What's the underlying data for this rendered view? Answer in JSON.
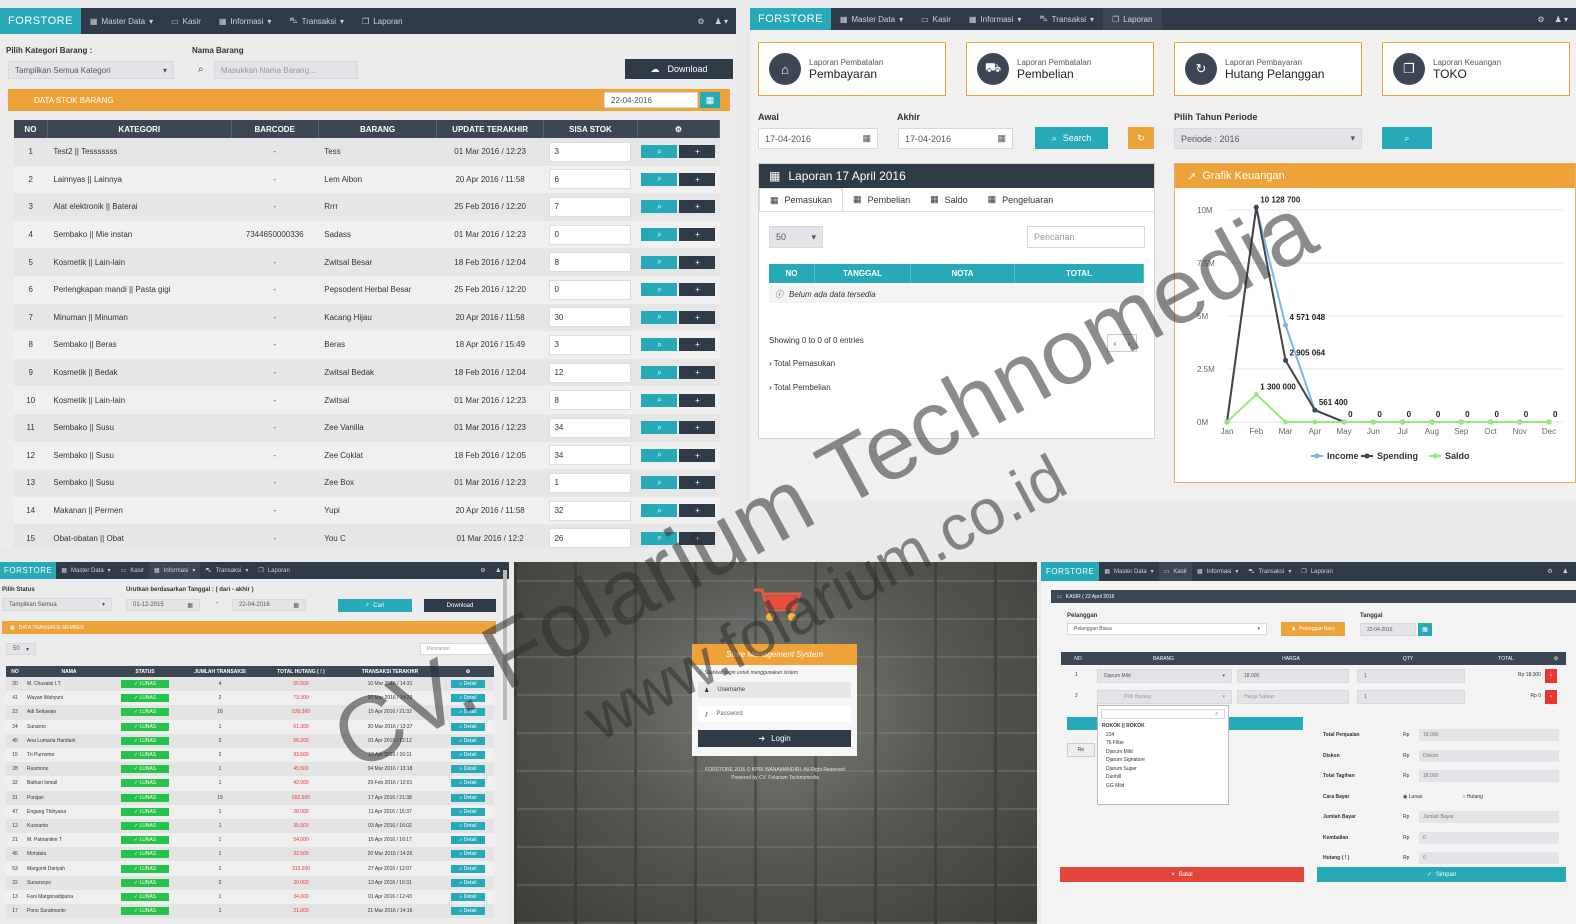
{
  "nav_common": {
    "brand": "FORSTORE",
    "master": "Master Data",
    "kasir": "Kasir",
    "informasi": "Informasi",
    "transaksi": "Transaksi",
    "laporan": "Laporan"
  },
  "p1": {
    "filter_label": "Pilih Kategori Barang :",
    "filter_value": "Tampilkan Semua Kategori",
    "name_label": "Nama Barang",
    "name_placeholder": "Masukkan Nama Barang...",
    "download": "Download",
    "panel_title": "DATA STOK BARANG",
    "date": "22-04-2016",
    "headers": [
      "NO",
      "KATEGORI",
      "BARCODE",
      "BARANG",
      "UPDATE TERAKHIR",
      "SISA STOK",
      "⚙"
    ],
    "rows": [
      [
        "1",
        "Test2 || Tesssssss",
        "-",
        "Tess",
        "01 Mar 2016 / 12:23",
        "3"
      ],
      [
        "2",
        "Lainnyas || Lainnya",
        "-",
        "Lem Aibon",
        "20 Apr 2016 / 11:58",
        "6"
      ],
      [
        "3",
        "Alat elektronik || Baterai",
        "-",
        "Rrrr",
        "25 Feb 2016 / 12:20",
        "7"
      ],
      [
        "4",
        "Sembako || Mie instan",
        "7344650000336",
        "Sadass",
        "01 Mar 2016 / 12:23",
        "0"
      ],
      [
        "5",
        "Kosmetik || Lain-lain",
        "-",
        "Zwitsal Besar",
        "18 Feb 2016 / 12:04",
        "8"
      ],
      [
        "6",
        "Perlengkapan mandi || Pasta gigi",
        "-",
        "Pepsodent Herbal Besar",
        "25 Feb 2016 / 12:20",
        "0"
      ],
      [
        "7",
        "Minuman || Minuman",
        "-",
        "Kacang Hijau",
        "20 Apr 2016 / 11:58",
        "30"
      ],
      [
        "8",
        "Sembako || Beras",
        "-",
        "Beras",
        "18 Apr 2016 / 15:49",
        "3"
      ],
      [
        "9",
        "Kosmetik || Bedak",
        "-",
        "Zwitsal Bedak",
        "18 Feb 2016 / 12:04",
        "12"
      ],
      [
        "10",
        "Kosmetik || Lain-lain",
        "-",
        "Zwitsal",
        "01 Mar 2016 / 12:23",
        "8"
      ],
      [
        "11",
        "Sembako || Susu",
        "-",
        "Zee Vanilla",
        "01 Mar 2016 / 12:23",
        "34"
      ],
      [
        "12",
        "Sembako || Susu",
        "-",
        "Zee Coklat",
        "18 Feb 2016 / 12:05",
        "34"
      ],
      [
        "13",
        "Sembako || Susu",
        "-",
        "Zee Box",
        "01 Mar 2016 / 12:23",
        "1"
      ],
      [
        "14",
        "Makanan || Permen",
        "-",
        "Yupi",
        "20 Apr 2016 / 11:58",
        "32"
      ],
      [
        "15",
        "Obat-obatan || Obat",
        "-",
        "You C",
        "01 Mar 2016 / 12:2",
        "26"
      ]
    ]
  },
  "p2": {
    "cards": [
      {
        "small": "Laporan Pembatalan",
        "big": "Pembayaran",
        "icon": "⌂"
      },
      {
        "small": "Laporan Pembatalan",
        "big": "Pembelian",
        "icon": "⛟"
      },
      {
        "small": "Laporan Pembayaran",
        "big": "Hutang Pelanggan",
        "icon": "↻"
      },
      {
        "small": "Laporan Keuangan",
        "big": "TOKO",
        "icon": "❐"
      }
    ],
    "awal_label": "Awal",
    "akhir_label": "Akhir",
    "awal": "17-04-2016",
    "akhir": "17-04-2016",
    "search": "Search",
    "period_label": "Pilih Tahun Periode",
    "period": "Periode : 2016",
    "laporan_title": "Laporan 17 April 2016",
    "tabs": [
      "Pemasukan",
      "Pembelian",
      "Saldo",
      "Pengeluaran"
    ],
    "page_size": "50",
    "search_placeholder": "Pencarian",
    "cols": [
      "NO",
      "TANGGAL",
      "NOTA",
      "TOTAL"
    ],
    "empty": "Belum ada data tersedia",
    "showing": "Showing 0 to 0 of 0 entries",
    "total_pemasukan": "Total Pemasukan",
    "total_pembelian": "Total Pembelian",
    "chart_header": "Grafik Keuangan"
  },
  "chart_data": {
    "type": "line",
    "title": "Grafik Keuangan",
    "categories": [
      "Jan",
      "Feb",
      "Mar",
      "Apr",
      "May",
      "Jun",
      "Jul",
      "Aug",
      "Sep",
      "Oct",
      "Nov",
      "Dec"
    ],
    "series": [
      {
        "name": "Income",
        "color": "#7cb5ec",
        "values": [
          0,
          10128700,
          4571048,
          561400,
          0,
          0,
          0,
          0,
          0,
          0,
          0,
          0
        ]
      },
      {
        "name": "Spending",
        "color": "#434348",
        "values": [
          0,
          10128700,
          2905064,
          561400,
          0,
          0,
          0,
          0,
          0,
          0,
          0,
          0
        ]
      },
      {
        "name": "Saldo",
        "color": "#90ed7d",
        "values": [
          0,
          1300000,
          0,
          0,
          0,
          0,
          0,
          0,
          0,
          0,
          0,
          0
        ]
      }
    ],
    "labels": [
      {
        "cat": "Feb",
        "value": 10128700,
        "text": "10 128 700"
      },
      {
        "cat": "Mar",
        "value": 4571048,
        "text": "4 571 048"
      },
      {
        "cat": "Mar",
        "value": 2905064,
        "text": "2 905 064"
      },
      {
        "cat": "Feb",
        "value": 1300000,
        "text": "1 300 000"
      },
      {
        "cat": "Apr",
        "value": 561400,
        "text": "561 400"
      },
      {
        "cat": "May",
        "value": 0,
        "text": "0"
      },
      {
        "cat": "Jun",
        "value": 0,
        "text": "0"
      },
      {
        "cat": "Jul",
        "value": 0,
        "text": "0"
      },
      {
        "cat": "Aug",
        "value": 0,
        "text": "0"
      },
      {
        "cat": "Sep",
        "value": 0,
        "text": "0"
      },
      {
        "cat": "Oct",
        "value": 0,
        "text": "0"
      },
      {
        "cat": "Nov",
        "value": 0,
        "text": "0"
      },
      {
        "cat": "Dec",
        "value": 0,
        "text": "0"
      }
    ],
    "ylim": [
      0,
      10000000
    ],
    "yticks": [
      "0M",
      "2.5M",
      "5M",
      "7.5M",
      "10M"
    ]
  },
  "p3": {
    "f1_label": "Pilih Status",
    "f2_label": "Urutkan berdasarkan Tanggal : ( dari - akhir )",
    "f1_value": "Tampilkan Semua",
    "from": "01-12-2015",
    "to": "22-04-2016",
    "cari": "Cari",
    "download": "Download",
    "panel_title": "DATA TRANSAKSI MEMBER",
    "page_size": "50",
    "search_placeholder": "Pencarian",
    "headers": [
      "NO",
      "NAMA",
      "STATUS",
      "JUMLAH TRANSAKSI",
      "TOTAL HUTANG ( ! )",
      "TRANSAKSI TERAKHIR",
      "⚙"
    ],
    "status": "✓ LUNAS",
    "detail": "Detail",
    "rows": [
      [
        "20",
        "M. Chusaini I.T",
        "4",
        "65.500",
        "10 Mar 2016 / 14:31"
      ],
      [
        "41",
        "Wayan Wahyuni",
        "2",
        "73.300",
        "20 Mar 2016 / 14:29"
      ],
      [
        "23",
        "Adi Setiawan",
        "16",
        "520.300",
        "15 Apr 2016 / 21:32"
      ],
      [
        "24",
        "Sunarno",
        "1",
        "61.300",
        "30 Mar 2016 / 13:37"
      ],
      [
        "45",
        "Ana Lumaria Hardiani",
        "2",
        "56.200",
        "01 Apr 2016 / 12:12"
      ],
      [
        "15",
        "Tri Purnomo",
        "2",
        "93.500",
        "13 Apr 2016 / 16:11"
      ],
      [
        "28",
        "Rusmono",
        "1",
        "45.500",
        "04 Mar 2016 / 13:18"
      ],
      [
        "32",
        "Bathari Ismail",
        "1",
        "42.000",
        "29 Feb 2016 / 12:01"
      ],
      [
        "31",
        "Ponijan",
        "19",
        "692.500",
        "17 Apr 2016 / 21:38"
      ],
      [
        "47",
        "Engang Thihyana",
        "1",
        "28.000",
        "11 Apr 2016 / 16:37"
      ],
      [
        "12",
        "Kusnanto",
        "1",
        "35.500",
        "03 Apr 2016 / 16:02"
      ],
      [
        "21",
        "M. Patrianikm T",
        "1",
        "54.000",
        "15 Apr 2016 / 16:17"
      ],
      [
        "45",
        "Mohdala",
        "1",
        "32.500",
        "20 Mar 2016 / 14:26"
      ],
      [
        "53",
        "Margonit Dariyah",
        "1",
        "313.200",
        "27 Apr 2016 / 12:07"
      ],
      [
        "22",
        "Sunarsoyo",
        "2",
        "30.000",
        "13 Apr 2016 / 16:31"
      ],
      [
        "13",
        "Fani Margonadiputra",
        "1",
        "34.000",
        "01 Apr 2016 / 12:43"
      ],
      [
        "17",
        "Pono Suratmanto",
        "1",
        "21.000",
        "21 Mar 2016 / 14:16"
      ]
    ]
  },
  "p4": {
    "title": "Store Management System",
    "hint": "Silahkan login untuk menggunakan sistem",
    "username": "Username",
    "password": "Password",
    "login": "Login",
    "footer1": "FORSTORE 2016 © KPRI WANAMANDIRI. All Right Reserved",
    "footer2": "Powered by CV. Folarium Technomedia"
  },
  "p5": {
    "header": "KASIR ( 22 April 2016",
    "pelanggan_label": "Pelanggan",
    "pelanggan_value": "Pelanggan Biasa",
    "pelanggan_btn": "Pelanggan Baru",
    "tanggal_label": "Tanggal",
    "tanggal_value": "22-04-2016",
    "cols": [
      "NO",
      "BARANG",
      "HARGA",
      "QTY",
      "TOTAL",
      "⚙"
    ],
    "row1": {
      "no": "1",
      "barang": "Djarum Mild",
      "harga": "18.000",
      "total": "Rp 18.000"
    },
    "row2": {
      "no": "2",
      "barang": "Pilih Barang",
      "harga": "Harga Satuan",
      "total": "Rp 0"
    },
    "options": [
      "ROKOK || ROKOK",
      "234",
      "76 Filter",
      "Djarum Mild",
      "Djarum Signature",
      "Djarum Super",
      "Dunhill",
      "GG Mild"
    ],
    "sum_labels": [
      "Total Penjualan",
      "Diskon",
      "Total Tagihan",
      "Cara Bayar",
      "Jumlah Bayar",
      "Kembalian",
      "Hutang ( ! )"
    ],
    "sum_values": [
      "18.000",
      "Diskon",
      "18.000",
      "",
      "Jumlah Bayar",
      "0",
      "0"
    ],
    "pay_lunas": "Lunas",
    "pay_hutang": "Hutang",
    "batal": "Batal",
    "simpan": "Simpan"
  },
  "watermark": {
    "line1": "CV. Folarium Technomedia",
    "line2": "www.folarium.co.id"
  }
}
